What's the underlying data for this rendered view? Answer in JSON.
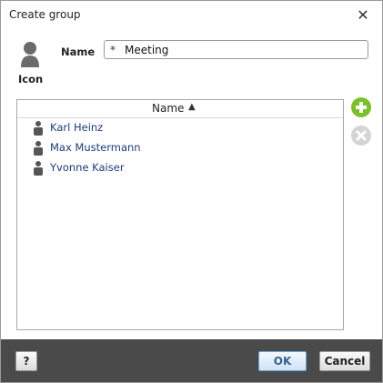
{
  "dialog": {
    "title": "Create group",
    "close_symbol": "✕"
  },
  "form": {
    "icon_label": "Icon",
    "name_label": "Name",
    "name_required_mark": "*",
    "name_value": "Meeting"
  },
  "list": {
    "header": "Name",
    "sort_indicator": "▲",
    "members": [
      {
        "label": "Karl Heinz"
      },
      {
        "label": "Max Mustermann"
      },
      {
        "label": "Yvonne Kaiser"
      }
    ]
  },
  "side_actions": {
    "add_icon": "plus-circle-icon",
    "remove_icon": "x-circle-icon",
    "add_color": "#7bc02a",
    "remove_color": "#d4d4d4"
  },
  "footer": {
    "help_label": "?",
    "ok_label": "OK",
    "cancel_label": "Cancel"
  }
}
